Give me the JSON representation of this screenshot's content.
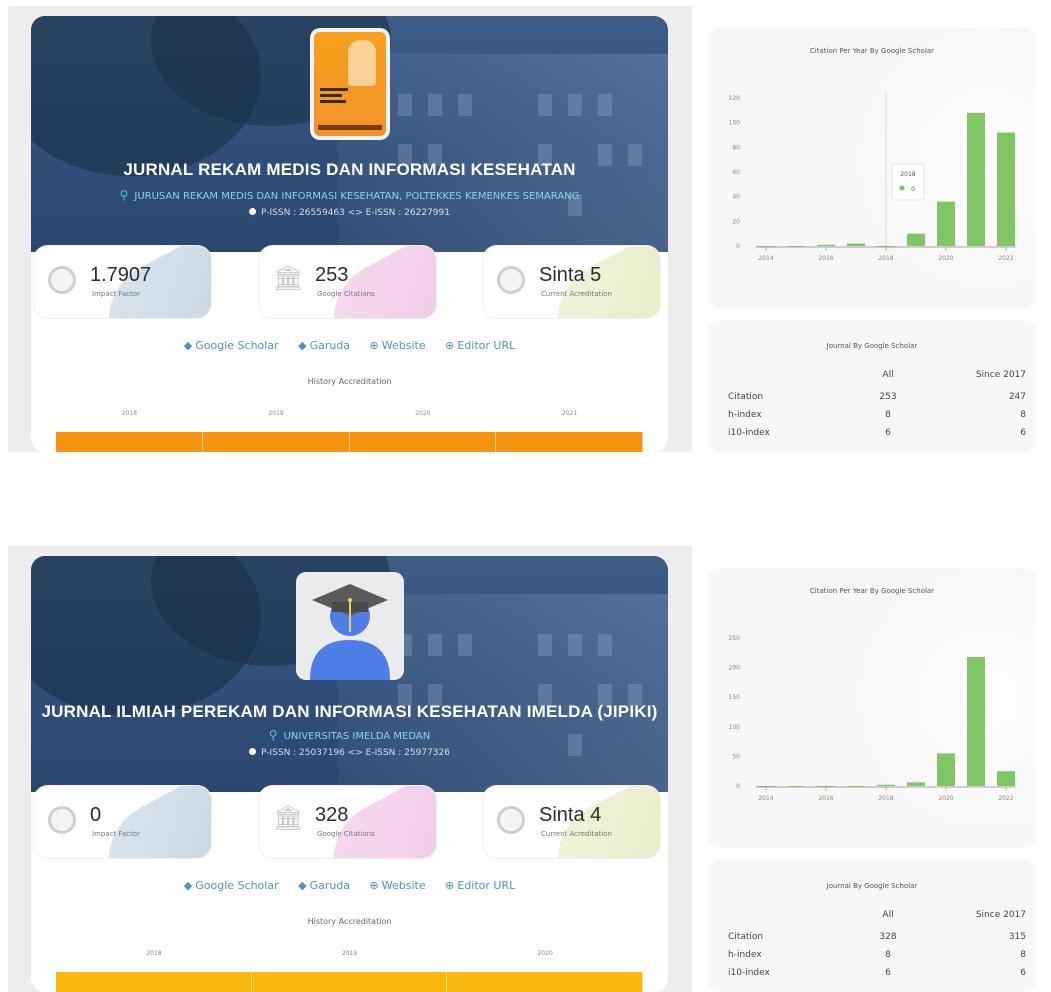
{
  "journals": [
    {
      "title": "JURNAL REKAM MEDIS DAN INFORMASI KESEHATAN",
      "institution": "JURUSAN REKAM MEDIS DAN INFORMASI KESEHATAN, POLTEKKES KEMENKES SEMARANG",
      "issn": "P-ISSN : 26559463 <> E-ISSN : 26227991",
      "cover_icon": "journal-cover-image",
      "stats": {
        "impact_factor": {
          "value": "1.7907",
          "label": "Impact Factor"
        },
        "google_citations": {
          "value": "253",
          "label": "Google Citations"
        },
        "accreditation": {
          "value": "Sinta 5",
          "label": "Current Acreditation"
        }
      },
      "links": [
        "Google Scholar",
        "Garuda",
        "Website",
        "Editor URL"
      ],
      "history_label": "History Accreditation",
      "history_years": [
        "2018",
        "2019",
        "2020",
        "2021"
      ],
      "history_bar_color": "#f7930f",
      "chart_data": {
        "type": "bar",
        "title": "Citation Per Year By Google Scholar",
        "x": [
          2014,
          2015,
          2016,
          2017,
          2018,
          2019,
          2020,
          2021,
          2022
        ],
        "values": [
          0,
          0,
          1,
          2,
          0,
          10,
          36,
          108,
          92
        ],
        "xticks": [
          "2014",
          "2016",
          "2018",
          "2020",
          "2022"
        ],
        "yticks": [
          0,
          20,
          40,
          60,
          80,
          100,
          120
        ],
        "ylim": [
          0,
          120
        ],
        "grid": false,
        "bar_color": "#7fc665",
        "tooltip": {
          "label": "2018",
          "value": "0"
        }
      },
      "scholar_table": {
        "title": "Journal By Google Scholar",
        "headers": [
          "",
          "All",
          "Since 2017"
        ],
        "rows": [
          [
            "Citation",
            "253",
            "247"
          ],
          [
            "h-index",
            "8",
            "8"
          ],
          [
            "i10-index",
            "6",
            "6"
          ]
        ]
      }
    },
    {
      "title": "JURNAL ILMIAH PEREKAM DAN INFORMASI KESEHATAN IMELDA (JIPIKI)",
      "institution": "UNIVERSITAS IMELDA MEDAN",
      "issn": "P-ISSN : 25037196 <> E-ISSN : 25977326",
      "cover_icon": "graduate-avatar-icon",
      "stats": {
        "impact_factor": {
          "value": "0",
          "label": "Impact Factor"
        },
        "google_citations": {
          "value": "328",
          "label": "Google Citations"
        },
        "accreditation": {
          "value": "Sinta 4",
          "label": "Current Acreditation"
        }
      },
      "links": [
        "Google Scholar",
        "Garuda",
        "Website",
        "Editor URL"
      ],
      "history_label": "History Accreditation",
      "history_years": [
        "2018",
        "2019",
        "2020"
      ],
      "history_bar_color": "#f9b80b",
      "chart_data": {
        "type": "bar",
        "title": "Citation Per Year By Google Scholar",
        "x": [
          2014,
          2015,
          2016,
          2017,
          2018,
          2019,
          2020,
          2021,
          2022
        ],
        "values": [
          0,
          0,
          0,
          0,
          2,
          6,
          55,
          218,
          25
        ],
        "xticks": [
          "2014",
          "2016",
          "2018",
          "2020",
          "2022"
        ],
        "yticks": [
          0,
          50,
          100,
          150,
          200,
          250
        ],
        "ylim": [
          0,
          250
        ],
        "grid": false,
        "bar_color": "#7fc665"
      },
      "scholar_table": {
        "title": "Journal By Google Scholar",
        "headers": [
          "",
          "All",
          "Since 2017"
        ],
        "rows": [
          [
            "Citation",
            "328",
            "315"
          ],
          [
            "h-index",
            "8",
            "8"
          ],
          [
            "i10-index",
            "6",
            "6"
          ]
        ]
      }
    }
  ]
}
